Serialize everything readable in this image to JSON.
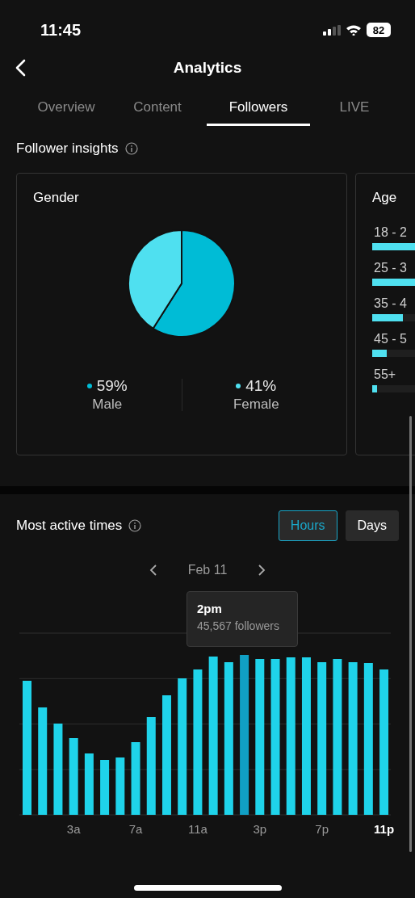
{
  "status_bar": {
    "time": "11:45",
    "battery": "82"
  },
  "header": {
    "title": "Analytics"
  },
  "tabs": [
    {
      "label": "Overview",
      "selected": false
    },
    {
      "label": "Content",
      "selected": false
    },
    {
      "label": "Followers",
      "selected": true
    },
    {
      "label": "LIVE",
      "selected": false
    }
  ],
  "follower_insights": {
    "title": "Follower insights",
    "gender": {
      "title": "Gender",
      "chart_data": {
        "type": "pie",
        "categories": [
          "Male",
          "Female"
        ],
        "series": [
          {
            "values": [
              59,
              41
            ]
          }
        ]
      },
      "legend": [
        {
          "value": "59%",
          "color": "#00bcd6"
        },
        {
          "value": "41%",
          "color": "#4fe0f0"
        }
      ]
    },
    "age": {
      "title": "Age",
      "groups": [
        {
          "label": "18 - 2",
          "level": 1
        },
        {
          "label": "25 - 3",
          "level": 1
        },
        {
          "label": "35 - 4",
          "level": 0.72
        },
        {
          "label": "45 - 5",
          "level": 0.34
        },
        {
          "label": "55+",
          "level": 0.11
        }
      ]
    }
  },
  "most_active_times": {
    "title": "Most active times",
    "toggle": [
      {
        "label": "Hours",
        "selected": true
      },
      {
        "label": "Days",
        "selected": false
      }
    ],
    "date": "Feb 11",
    "tooltip": {
      "time": "2pm",
      "count": "45,567 followers"
    },
    "bars": [
      {
        "selected": false
      },
      {
        "selected": false
      },
      {
        "selected": false
      },
      {
        "selected": false
      },
      {
        "selected": false
      },
      {
        "selected": false
      },
      {
        "selected": false
      },
      {
        "selected": false
      },
      {
        "selected": false
      },
      {
        "selected": false
      },
      {
        "selected": false
      },
      {
        "selected": false
      },
      {
        "selected": false
      },
      {
        "selected": false
      },
      {
        "selected": true
      },
      {
        "selected": false
      },
      {
        "selected": false
      },
      {
        "selected": false
      },
      {
        "selected": false
      },
      {
        "selected": false
      },
      {
        "selected": false
      },
      {
        "selected": false
      },
      {
        "selected": false
      },
      {
        "selected": false
      }
    ],
    "x_labels": [
      {
        "text": "3a",
        "selected": false
      },
      {
        "text": "7a",
        "selected": false
      },
      {
        "text": "11a",
        "selected": false
      },
      {
        "text": "3p",
        "selected": false
      },
      {
        "text": "7p",
        "selected": false
      },
      {
        "text": "11p",
        "selected": true
      }
    ]
  }
}
